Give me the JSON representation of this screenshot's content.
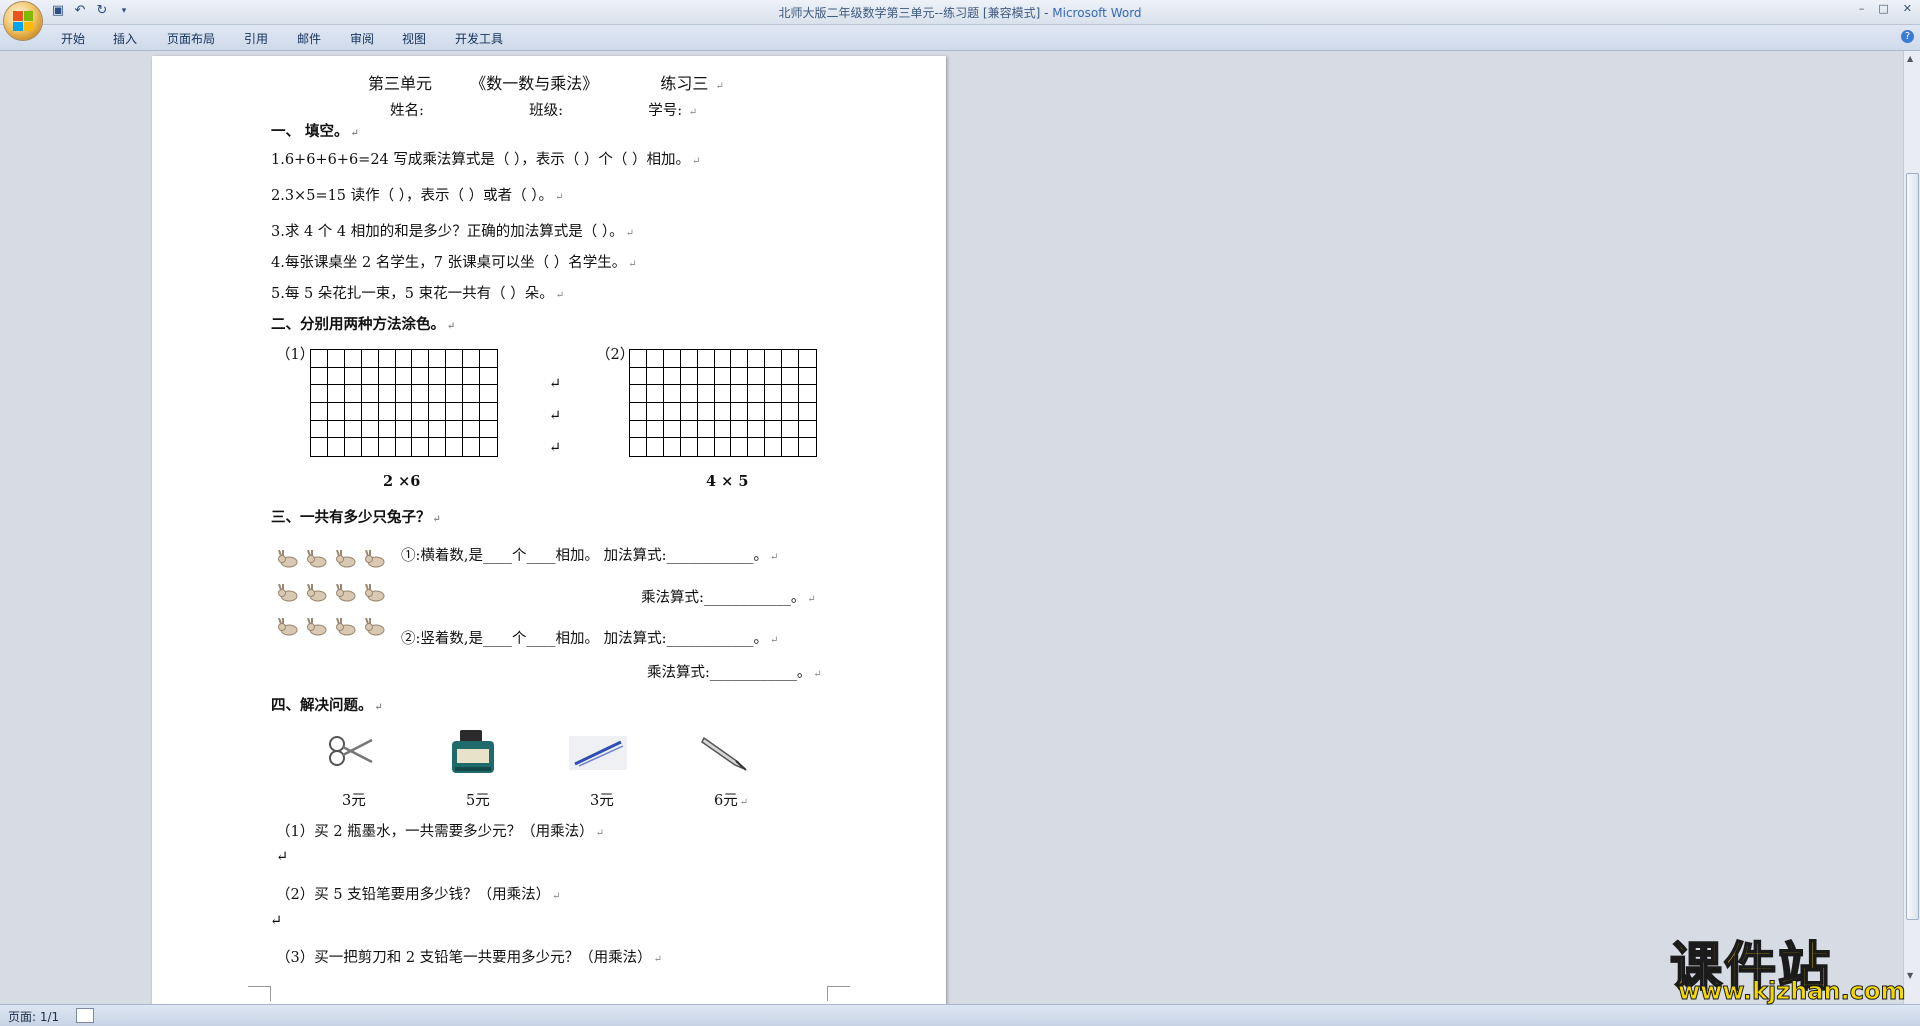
{
  "window": {
    "title_prefix": "北师大版二年级数学第三单元--练习题 [兼容模式] - ",
    "title_brand": "Microsoft Word",
    "controls": [
      "–",
      "□",
      "✕"
    ]
  },
  "qat": {
    "icons": [
      "save-icon",
      "undo-icon",
      "redo-icon",
      "customize-icon"
    ]
  },
  "ribbon": {
    "tabs": [
      "开始",
      "插入",
      "页面布局",
      "引用",
      "邮件",
      "审阅",
      "视图",
      "开发工具"
    ],
    "help": "?"
  },
  "document": {
    "header": {
      "unit": "第三单元",
      "topic": "《数一数与乘法》",
      "exercise": "练习三"
    },
    "info": {
      "name": "姓名:",
      "class": "班级:",
      "id": "学号:"
    },
    "s1": {
      "heading": "一、  填空。",
      "q1": "1.6+6+6+6=24 写成乘法算式是（        ），表示（    ）个（    ）相加。",
      "q2": "2.3×5=15 读作（        ），表示（         ）或者（         ）。",
      "q3": "3.求 4 个 4 相加的和是多少？正确的加法算式是（         ）。",
      "q4": "4.每张课桌坐 2 名学生，7 张课桌可以坐（     ）名学生。",
      "q5": "5.每 5 朵花扎一束，5 束花一共有（     ）朵。"
    },
    "s2": {
      "heading": "二、分别用两种方法涂色。",
      "g1_label": "（1）",
      "g2_label": "（2）",
      "g1_caption": "2 ×6",
      "g2_caption": "4 × 5"
    },
    "s3": {
      "heading": "三、一共有多少只兔子？",
      "l1": "①:横着数,是____个____相加。  加法算式:____________。",
      "l2": "乘法算式:____________。",
      "l3": "②:竖着数,是____个____相加。  加法算式:____________。",
      "l4": "乘法算式:____________。"
    },
    "s4": {
      "heading": "四、解决问题。",
      "items": [
        {
          "icon": "scissors-icon",
          "price": "3元"
        },
        {
          "icon": "ink-bottle-icon",
          "price": "5元"
        },
        {
          "icon": "pencil-icon",
          "price": "3元"
        },
        {
          "icon": "pen-icon",
          "price": "6元"
        }
      ],
      "p1": "（1）买 2 瓶墨水，一共需要多少元？（用乘法）",
      "p2": "（2）买 5 支铅笔要用多少钱？（用乘法）",
      "p3": "（3）买一把剪刀和 2 支铅笔一共要用多少元？（用乘法）"
    },
    "para_mark": "↵"
  },
  "status": {
    "page": "页面: 1/1"
  },
  "watermark": {
    "cn": "课件站",
    "url": "www.kjzhan.com"
  }
}
